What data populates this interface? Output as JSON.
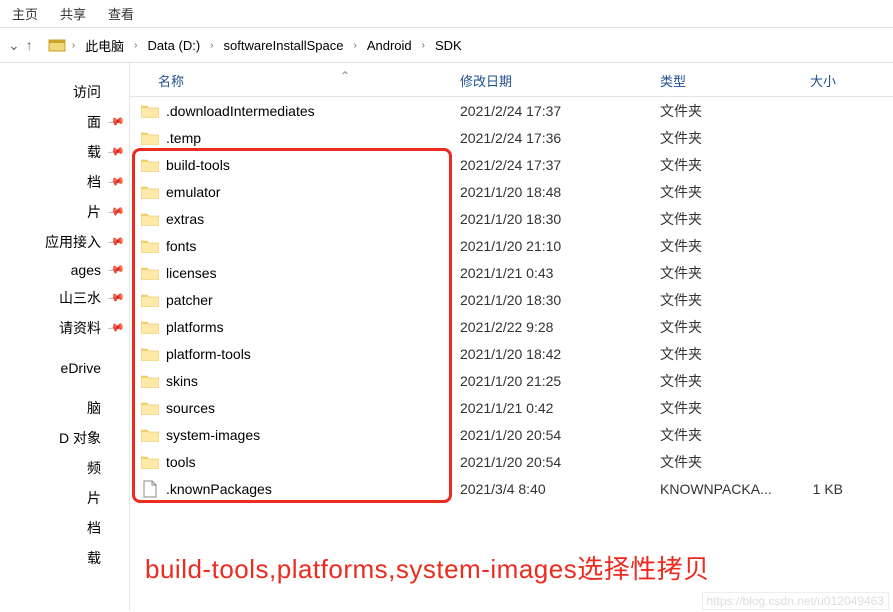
{
  "menu": {
    "home": "主页",
    "share": "共享",
    "view": "查看"
  },
  "nav": {
    "up": "↑"
  },
  "breadcrumbs": [
    "此电脑",
    "Data (D:)",
    "softwareInstallSpace",
    "Android",
    "SDK"
  ],
  "sidebar": [
    {
      "label": "访问",
      "pin": false
    },
    {
      "label": "面",
      "pin": true
    },
    {
      "label": "载",
      "pin": true
    },
    {
      "label": "档",
      "pin": true
    },
    {
      "label": "片",
      "pin": true
    },
    {
      "label": "应用接入",
      "pin": true
    },
    {
      "label": "ages",
      "pin": true
    },
    {
      "label": "山三水",
      "pin": true
    },
    {
      "label": "请资料",
      "pin": true
    },
    {
      "label": "",
      "spacer": true
    },
    {
      "label": "eDrive",
      "pin": false
    },
    {
      "label": "",
      "spacer": true
    },
    {
      "label": "脑",
      "pin": false
    },
    {
      "label": "D 对象",
      "pin": false
    },
    {
      "label": "频",
      "pin": false
    },
    {
      "label": "片",
      "pin": false
    },
    {
      "label": "档",
      "pin": false
    },
    {
      "label": "载",
      "pin": false
    }
  ],
  "columns": {
    "name": "名称",
    "date": "修改日期",
    "type": "类型",
    "size": "大小"
  },
  "files": [
    {
      "icon": "folder",
      "name": ".downloadIntermediates",
      "date": "2021/2/24 17:37",
      "type": "文件夹",
      "size": ""
    },
    {
      "icon": "folder",
      "name": ".temp",
      "date": "2021/2/24 17:36",
      "type": "文件夹",
      "size": ""
    },
    {
      "icon": "folder",
      "name": "build-tools",
      "date": "2021/2/24 17:37",
      "type": "文件夹",
      "size": ""
    },
    {
      "icon": "folder",
      "name": "emulator",
      "date": "2021/1/20 18:48",
      "type": "文件夹",
      "size": ""
    },
    {
      "icon": "folder",
      "name": "extras",
      "date": "2021/1/20 18:30",
      "type": "文件夹",
      "size": ""
    },
    {
      "icon": "folder",
      "name": "fonts",
      "date": "2021/1/20 21:10",
      "type": "文件夹",
      "size": ""
    },
    {
      "icon": "folder",
      "name": "licenses",
      "date": "2021/1/21 0:43",
      "type": "文件夹",
      "size": ""
    },
    {
      "icon": "folder",
      "name": "patcher",
      "date": "2021/1/20 18:30",
      "type": "文件夹",
      "size": ""
    },
    {
      "icon": "folder",
      "name": "platforms",
      "date": "2021/2/22 9:28",
      "type": "文件夹",
      "size": ""
    },
    {
      "icon": "folder",
      "name": "platform-tools",
      "date": "2021/1/20 18:42",
      "type": "文件夹",
      "size": ""
    },
    {
      "icon": "folder",
      "name": "skins",
      "date": "2021/1/20 21:25",
      "type": "文件夹",
      "size": ""
    },
    {
      "icon": "folder",
      "name": "sources",
      "date": "2021/1/21 0:42",
      "type": "文件夹",
      "size": ""
    },
    {
      "icon": "folder",
      "name": "system-images",
      "date": "2021/1/20 20:54",
      "type": "文件夹",
      "size": ""
    },
    {
      "icon": "folder",
      "name": "tools",
      "date": "2021/1/20 20:54",
      "type": "文件夹",
      "size": ""
    },
    {
      "icon": "file",
      "name": ".knownPackages",
      "date": "2021/3/4 8:40",
      "type": "KNOWNPACKA...",
      "size": "1 KB"
    }
  ],
  "annotation": "build-tools,platforms,system-images选择性拷贝",
  "watermark": "https://blog.csdn.net/u012049463"
}
